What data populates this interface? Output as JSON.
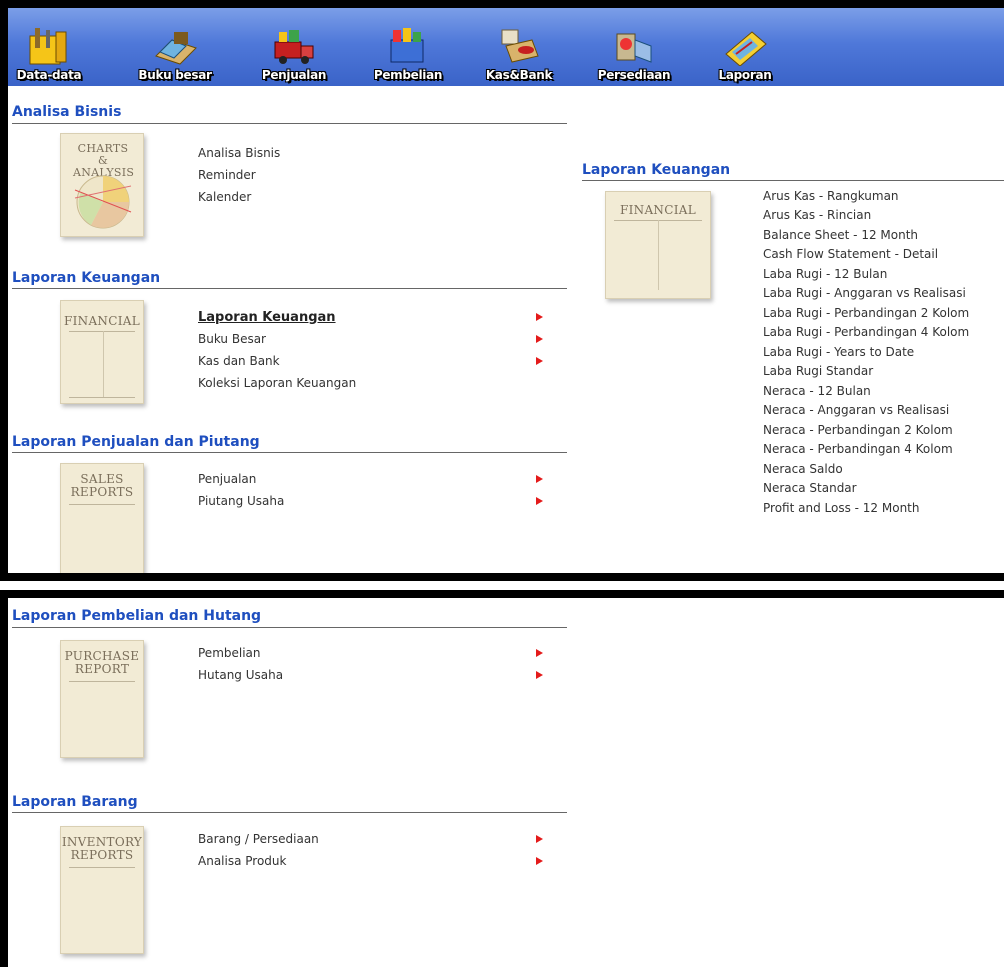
{
  "toolbar": {
    "items": [
      {
        "label": "Data-data",
        "icon": "data-icon"
      },
      {
        "label": "Buku besar",
        "icon": "ledger-icon"
      },
      {
        "label": "Penjualan",
        "icon": "sales-truck-icon"
      },
      {
        "label": "Pembelian",
        "icon": "purchase-icon"
      },
      {
        "label": "Kas&Bank",
        "icon": "cash-bank-icon"
      },
      {
        "label": "Persediaan",
        "icon": "inventory-icon"
      },
      {
        "label": "Laporan",
        "icon": "report-icon"
      }
    ]
  },
  "sections": {
    "analisa": {
      "title": "Analisa Bisnis",
      "thumb": "CHARTS & ANALYSIS",
      "links": [
        "Analisa Bisnis",
        "Reminder",
        "Kalender"
      ]
    },
    "keuangan": {
      "title": "Laporan Keuangan",
      "thumb": "FINANCIAL",
      "links": [
        "Laporan Keuangan",
        "Buku Besar",
        "Kas dan Bank",
        "Koleksi Laporan Keuangan"
      ]
    },
    "penjualan": {
      "title": "Laporan Penjualan dan Piutang",
      "thumb_line1": "SALES",
      "thumb_line2": "REPORTS",
      "links": [
        "Penjualan",
        "Piutang Usaha"
      ]
    },
    "pembelian": {
      "title": "Laporan Pembelian dan Hutang",
      "thumb_line1": "PURCHASE",
      "thumb_line2": "REPORT",
      "links": [
        "Pembelian",
        "Hutang Usaha"
      ]
    },
    "barang": {
      "title": "Laporan Barang",
      "thumb_line1": "INVENTORY",
      "thumb_line2": "REPORTS",
      "links": [
        "Barang / Persediaan",
        "Analisa Produk"
      ]
    }
  },
  "submenu": {
    "title": "Laporan Keuangan",
    "thumb": "FINANCIAL",
    "items": [
      "Arus Kas - Rangkuman",
      "Arus Kas - Rincian",
      "Balance Sheet - 12 Month",
      "Cash Flow Statement - Detail",
      "Laba Rugi - 12 Bulan",
      "Laba Rugi - Anggaran vs Realisasi",
      "Laba Rugi - Perbandingan 2 Kolom",
      "Laba Rugi - Perbandingan 4 Kolom",
      "Laba Rugi - Years to Date",
      "Laba Rugi Standar",
      "Neraca - 12 Bulan",
      "Neraca - Anggaran vs Realisasi",
      "Neraca - Perbandingan 2 Kolom",
      "Neraca - Perbandingan 4 Kolom",
      "Neraca Saldo",
      "Neraca Standar",
      "Profit and Loss - 12 Month"
    ]
  },
  "colors": {
    "title": "#1f4fbf",
    "arrow": "#e41b1b",
    "toolbar": "#4f78d9"
  }
}
